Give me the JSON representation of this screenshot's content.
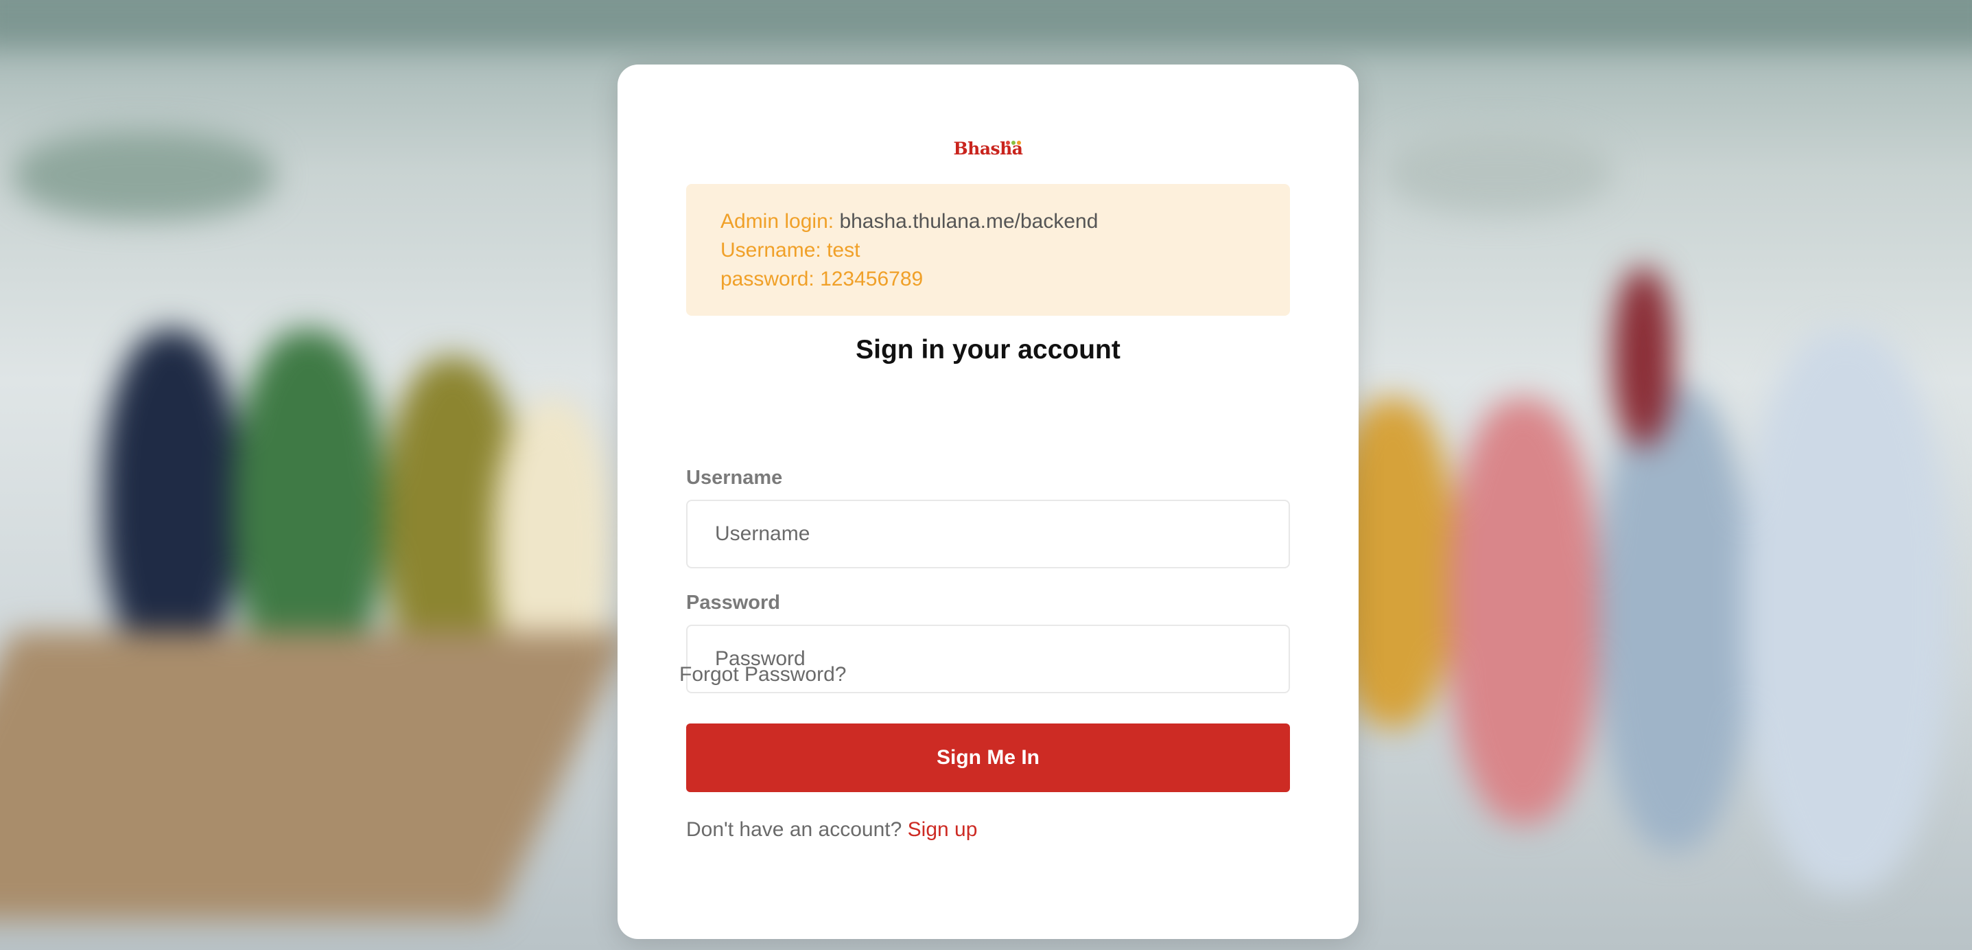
{
  "brand": {
    "logo_text": "Bhasha",
    "dot_colors": [
      "#e0463c",
      "#8bbf3f",
      "#f0a028",
      "#c9241d"
    ],
    "accent_color": "#cd2b24"
  },
  "notice": {
    "admin_label": "Admin login:",
    "admin_url": "bhasha.thulana.me/backend",
    "username_line": "Username: test",
    "password_line": "password: 123456789"
  },
  "form": {
    "heading": "Sign in your account",
    "username_label": "Username",
    "username_placeholder": "Username",
    "username_value": "",
    "password_label": "Password",
    "password_placeholder": "Password",
    "password_value": "",
    "forgot_link": "Forgot Password?",
    "submit_label": "Sign Me In",
    "signup_prompt": "Don't have an account?",
    "signup_link": "Sign up"
  }
}
